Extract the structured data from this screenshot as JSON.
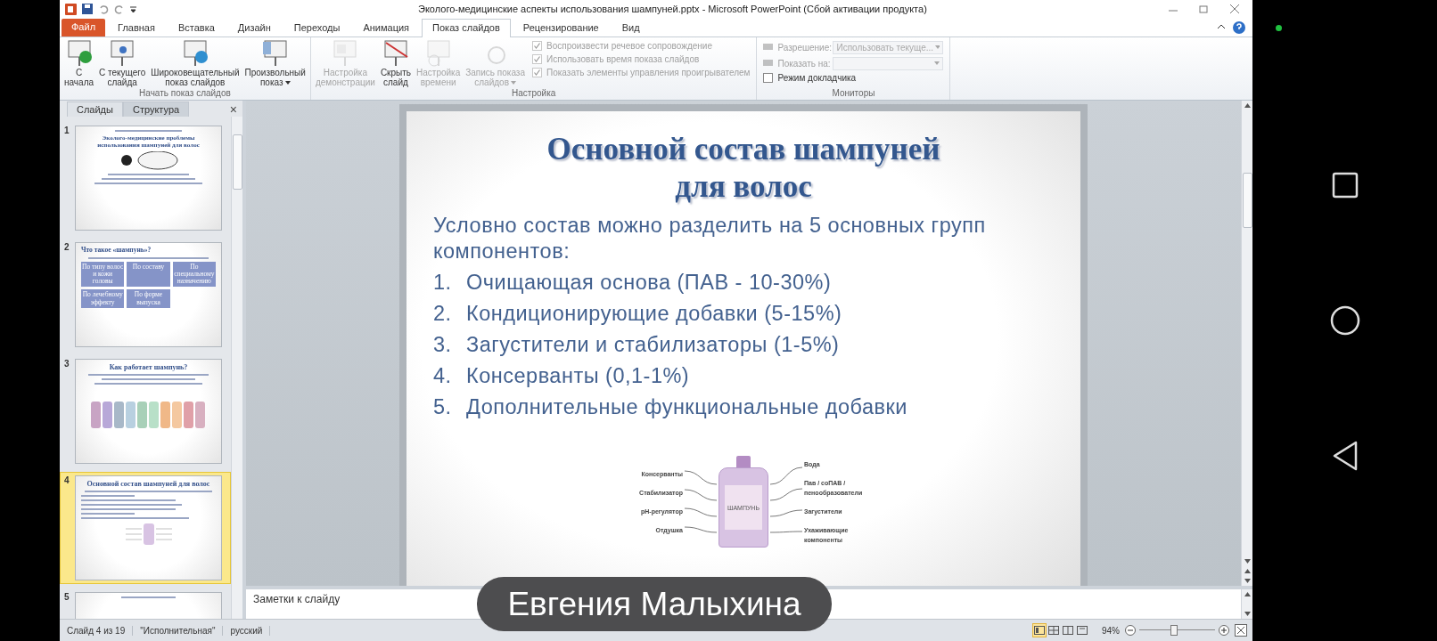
{
  "title_bar": {
    "title": "Эколого-медицинские аспекты использования шампуней.pptx  -  Microsoft PowerPoint (Сбой активации продукта)"
  },
  "ribbon": {
    "file_tab": "Файл",
    "tabs": [
      {
        "label": "Главная",
        "selected": false
      },
      {
        "label": "Вставка",
        "selected": false
      },
      {
        "label": "Дизайн",
        "selected": false
      },
      {
        "label": "Переходы",
        "selected": false
      },
      {
        "label": "Анимация",
        "selected": false
      },
      {
        "label": "Показ слайдов",
        "selected": true
      },
      {
        "label": "Рецензирование",
        "selected": false
      },
      {
        "label": "Вид",
        "selected": false
      }
    ],
    "groups": [
      {
        "label": "Начать показ слайдов",
        "buttons": [
          {
            "lines": [
              "С",
              "начала"
            ],
            "disabled": false,
            "dropdown": false
          },
          {
            "lines": [
              "С текущего",
              "слайда"
            ],
            "disabled": false,
            "dropdown": false
          },
          {
            "lines": [
              "Широковещательный",
              "показ слайдов"
            ],
            "disabled": false,
            "dropdown": false
          },
          {
            "lines": [
              "Произвольный",
              "показ"
            ],
            "disabled": false,
            "dropdown": true
          }
        ]
      },
      {
        "label": "Настройка",
        "buttons": [
          {
            "lines": [
              "Настройка",
              "демонстрации"
            ],
            "disabled": true,
            "dropdown": false
          },
          {
            "lines": [
              "Скрыть",
              "слайд"
            ],
            "disabled": false,
            "dropdown": false
          },
          {
            "lines": [
              "Настройка",
              "времени"
            ],
            "disabled": true,
            "dropdown": false
          },
          {
            "lines": [
              "Запись показа",
              "слайдов"
            ],
            "disabled": true,
            "dropdown": true
          }
        ],
        "checkboxes": [
          {
            "label": "Воспроизвести речевое сопровождение",
            "checked": true,
            "disabled": true
          },
          {
            "label": "Использовать время показа слайдов",
            "checked": true,
            "disabled": true
          },
          {
            "label": "Показать элементы управления проигрывателем",
            "checked": true,
            "disabled": true
          }
        ]
      },
      {
        "label": "Мониторы",
        "fields": [
          {
            "label": "Разрешение:",
            "value": "Использовать текуще...",
            "disabled": true
          },
          {
            "label": "Показать на:",
            "disabled": true
          }
        ],
        "checkboxes": [
          {
            "label": "Режим докладчика",
            "checked": false,
            "disabled": false
          }
        ]
      }
    ]
  },
  "slides_pane": {
    "tabs": [
      {
        "label": "Слайды",
        "selected": true
      },
      {
        "label": "Структура",
        "selected": false
      }
    ],
    "close": "×",
    "thumbnails": [
      {
        "number": "1",
        "kind": "title",
        "selected": false,
        "title": "Эколого-медицинские проблемы использования шампуней для волос"
      },
      {
        "number": "2",
        "kind": "boxes",
        "selected": false,
        "title": "Что такое «шампунь»?",
        "boxes": [
          "По типу волос и кожи головы",
          "По составу",
          "По специальному назначению",
          "По лечебному эффекту",
          "По форме выпуска"
        ]
      },
      {
        "number": "3",
        "kind": "image",
        "selected": false,
        "title": "Как работает  шампунь?"
      },
      {
        "number": "4",
        "kind": "list",
        "selected": true,
        "title": "Основной состав шампуней для волос"
      },
      {
        "number": "5",
        "kind": "cut",
        "selected": false
      }
    ]
  },
  "slide": {
    "title_lines": [
      "Основной состав шампуней",
      "для волос"
    ],
    "intro": "Условно состав можно разделить на 5 основных групп компонентов:",
    "items": [
      {
        "number": "1.",
        "text": "Очищающая основа (ПАВ - 10-30%)"
      },
      {
        "number": "2.",
        "text": "Кондиционирующие добавки (5-15%)"
      },
      {
        "number": "3.",
        "text": "Загустители и стабилизаторы (1-5%)"
      },
      {
        "number": "4.",
        "text": "Консерванты (0,1-1%)"
      },
      {
        "number": "5.",
        "text": "Дополнительные функциональные добавки"
      }
    ],
    "diagram": {
      "bottle_label": "ШАМПУНЬ",
      "left_labels": [
        "Консерванты",
        "Стабилизатор",
        "pH-регулятор",
        "Отдушка"
      ],
      "right_labels": [
        "Вода",
        "Пав / соПАВ / пенообразователи",
        "Загустители",
        "Ухаживающие компоненты"
      ]
    }
  },
  "notes": {
    "placeholder": "Заметки к слайду"
  },
  "status_bar": {
    "slide": "Слайд 4 из 19",
    "theme": "\"Исполнительная\"",
    "language": "русский",
    "views": [
      {
        "selected": true
      },
      {
        "selected": false
      },
      {
        "selected": false
      },
      {
        "selected": false
      }
    ],
    "zoom": {
      "reading": "94%",
      "level": 0.45
    }
  },
  "overlay": {
    "name": "Евгения Малыхина"
  }
}
